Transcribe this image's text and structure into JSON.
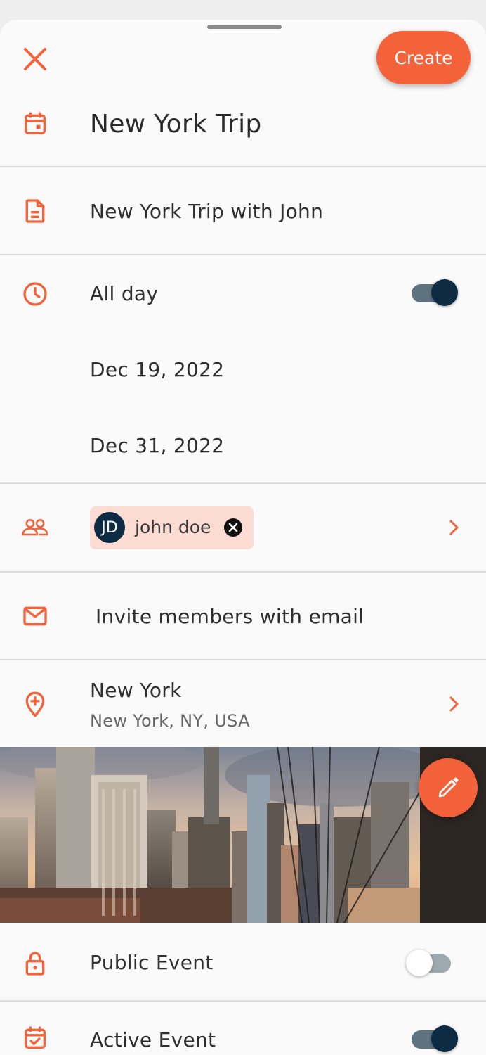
{
  "header": {
    "create_label": "Create",
    "close_icon": "close-icon"
  },
  "event": {
    "title": "New York Trip",
    "description": "New York Trip with John",
    "all_day_label": "All day",
    "all_day": true,
    "start_date": "Dec 19, 2022",
    "end_date": "Dec 31, 2022"
  },
  "members": {
    "chips": [
      {
        "initials": "JD",
        "name": "john doe"
      }
    ]
  },
  "invite": {
    "label": "Invite members with email"
  },
  "location": {
    "name": "New York",
    "address": "New York, NY, USA"
  },
  "settings": {
    "public_label": "Public Event",
    "public": false,
    "active_label": "Active Event",
    "active": true
  },
  "colors": {
    "accent": "#f4623a",
    "toggle_on": "#0d2c44",
    "chip_bg": "#fcdcd2"
  },
  "icons": [
    "close-icon",
    "calendar-icon",
    "document-icon",
    "clock-icon",
    "people-icon",
    "mail-icon",
    "location-pin-icon",
    "lock-icon",
    "calendar-check-icon",
    "chevron-right-icon",
    "pencil-icon"
  ]
}
